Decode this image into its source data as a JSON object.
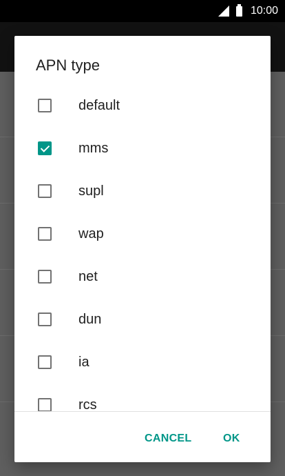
{
  "status_bar": {
    "time": "10:00"
  },
  "dialog": {
    "title": "APN type",
    "options": [
      {
        "label": "default",
        "checked": false
      },
      {
        "label": "mms",
        "checked": true
      },
      {
        "label": "supl",
        "checked": false
      },
      {
        "label": "wap",
        "checked": false
      },
      {
        "label": "net",
        "checked": false
      },
      {
        "label": "dun",
        "checked": false
      },
      {
        "label": "ia",
        "checked": false
      },
      {
        "label": "rcs",
        "checked": false
      }
    ],
    "cancel_label": "CANCEL",
    "ok_label": "OK"
  },
  "colors": {
    "accent": "#009688",
    "scrim": "#5e5e5e"
  }
}
